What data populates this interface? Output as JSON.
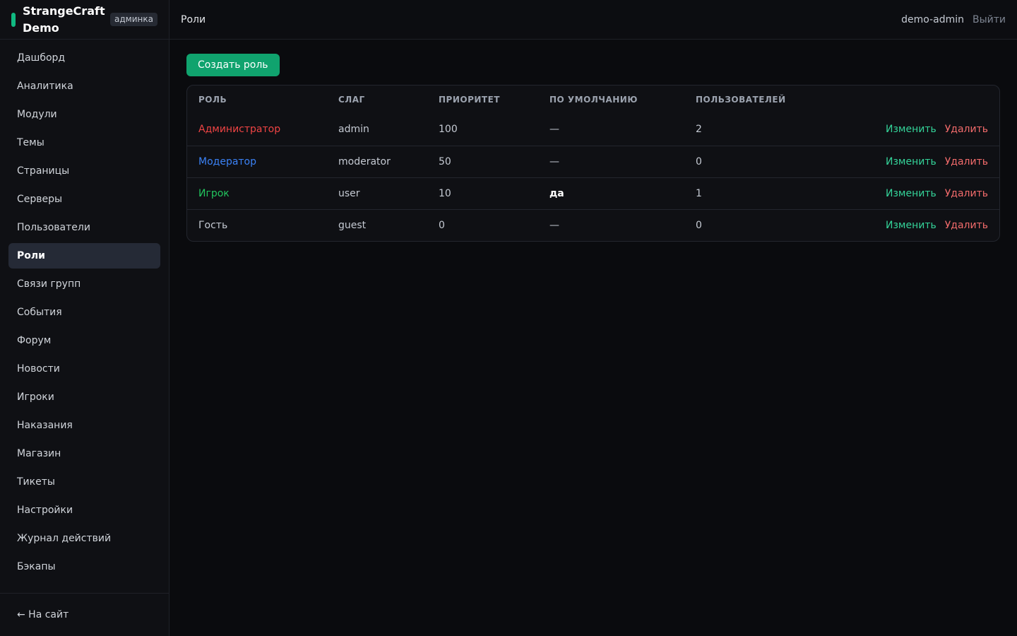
{
  "brand": {
    "name_line1": "StrangeCraft",
    "name_line2": "Demo",
    "badge": "админка",
    "accent": "#10b981"
  },
  "sidebar": {
    "items": [
      {
        "label": "Дашборд"
      },
      {
        "label": "Аналитика"
      },
      {
        "label": "Модули"
      },
      {
        "label": "Темы"
      },
      {
        "label": "Страницы"
      },
      {
        "label": "Серверы"
      },
      {
        "label": "Пользователи"
      },
      {
        "label": "Роли",
        "active": true
      },
      {
        "label": "Связи групп"
      },
      {
        "label": "События"
      },
      {
        "label": "Форум"
      },
      {
        "label": "Новости"
      },
      {
        "label": "Игроки"
      },
      {
        "label": "Наказания"
      },
      {
        "label": "Магазин"
      },
      {
        "label": "Тикеты"
      },
      {
        "label": "Настройки"
      },
      {
        "label": "Журнал действий"
      },
      {
        "label": "Бэкапы"
      }
    ],
    "back_link": "← На сайт"
  },
  "header": {
    "title": "Роли",
    "username": "demo-admin",
    "logout": "Выйти"
  },
  "main": {
    "create_button": "Создать роль",
    "table": {
      "columns": [
        "РОЛЬ",
        "СЛАГ",
        "ПРИОРИТЕТ",
        "ПО УМОЛЧАНИЮ",
        "ПОЛЬЗОВАТЕЛЕЙ"
      ],
      "edit_label": "Изменить",
      "delete_label": "Удалить",
      "rows": [
        {
          "role": "Администратор",
          "role_color": "#ef4444",
          "slug": "admin",
          "priority": "100",
          "default": "—",
          "users": "2"
        },
        {
          "role": "Модератор",
          "role_color": "#3b82f6",
          "slug": "moderator",
          "priority": "50",
          "default": "—",
          "users": "0"
        },
        {
          "role": "Игрок",
          "role_color": "#22c55e",
          "slug": "user",
          "priority": "10",
          "default": "да",
          "users": "1"
        },
        {
          "role": "Гость",
          "role_color": "#c5cad3",
          "slug": "guest",
          "priority": "0",
          "default": "—",
          "users": "0"
        }
      ]
    }
  }
}
